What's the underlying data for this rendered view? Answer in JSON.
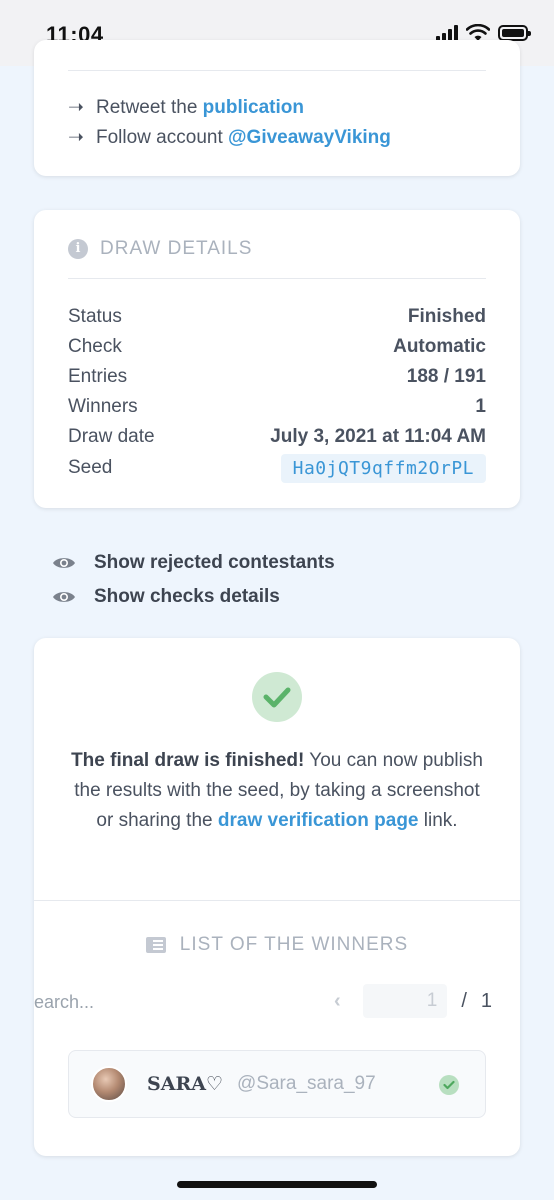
{
  "status_bar": {
    "time": "11:04"
  },
  "requirements": [
    {
      "text": "Retweet the ",
      "link": "publication"
    },
    {
      "text": "Follow account ",
      "link": "@GiveawayViking"
    }
  ],
  "draw_details": {
    "title": "DRAW DETAILS",
    "rows": [
      {
        "label": "Status",
        "value": "Finished"
      },
      {
        "label": "Check",
        "value": "Automatic"
      },
      {
        "label": "Entries",
        "value": "188 / 191"
      },
      {
        "label": "Winners",
        "value": "1"
      },
      {
        "label": "Draw date",
        "value": "July 3, 2021 at 11:04 AM"
      }
    ],
    "seed_label": "Seed",
    "seed_value": "Ha0jQT9qffm2OrPL"
  },
  "toggles": {
    "rejected": "Show rejected contestants",
    "checks": "Show checks details"
  },
  "result": {
    "bold": "The final draw is finished!",
    "text1": " You can now publish the results with the seed, by taking a screenshot or sharing the ",
    "link": "draw verification page",
    "text2": " link."
  },
  "winners": {
    "title": "LIST OF THE WINNERS",
    "search_placeholder": "earch...",
    "page_current": "1",
    "page_separator": "/",
    "page_total": "1",
    "items": [
      {
        "name": "SARA♡",
        "handle": "@Sara_sara_97"
      }
    ]
  },
  "colors": {
    "accent": "#3a96d6",
    "success": "#5bb36a",
    "background": "#eef5fd"
  }
}
